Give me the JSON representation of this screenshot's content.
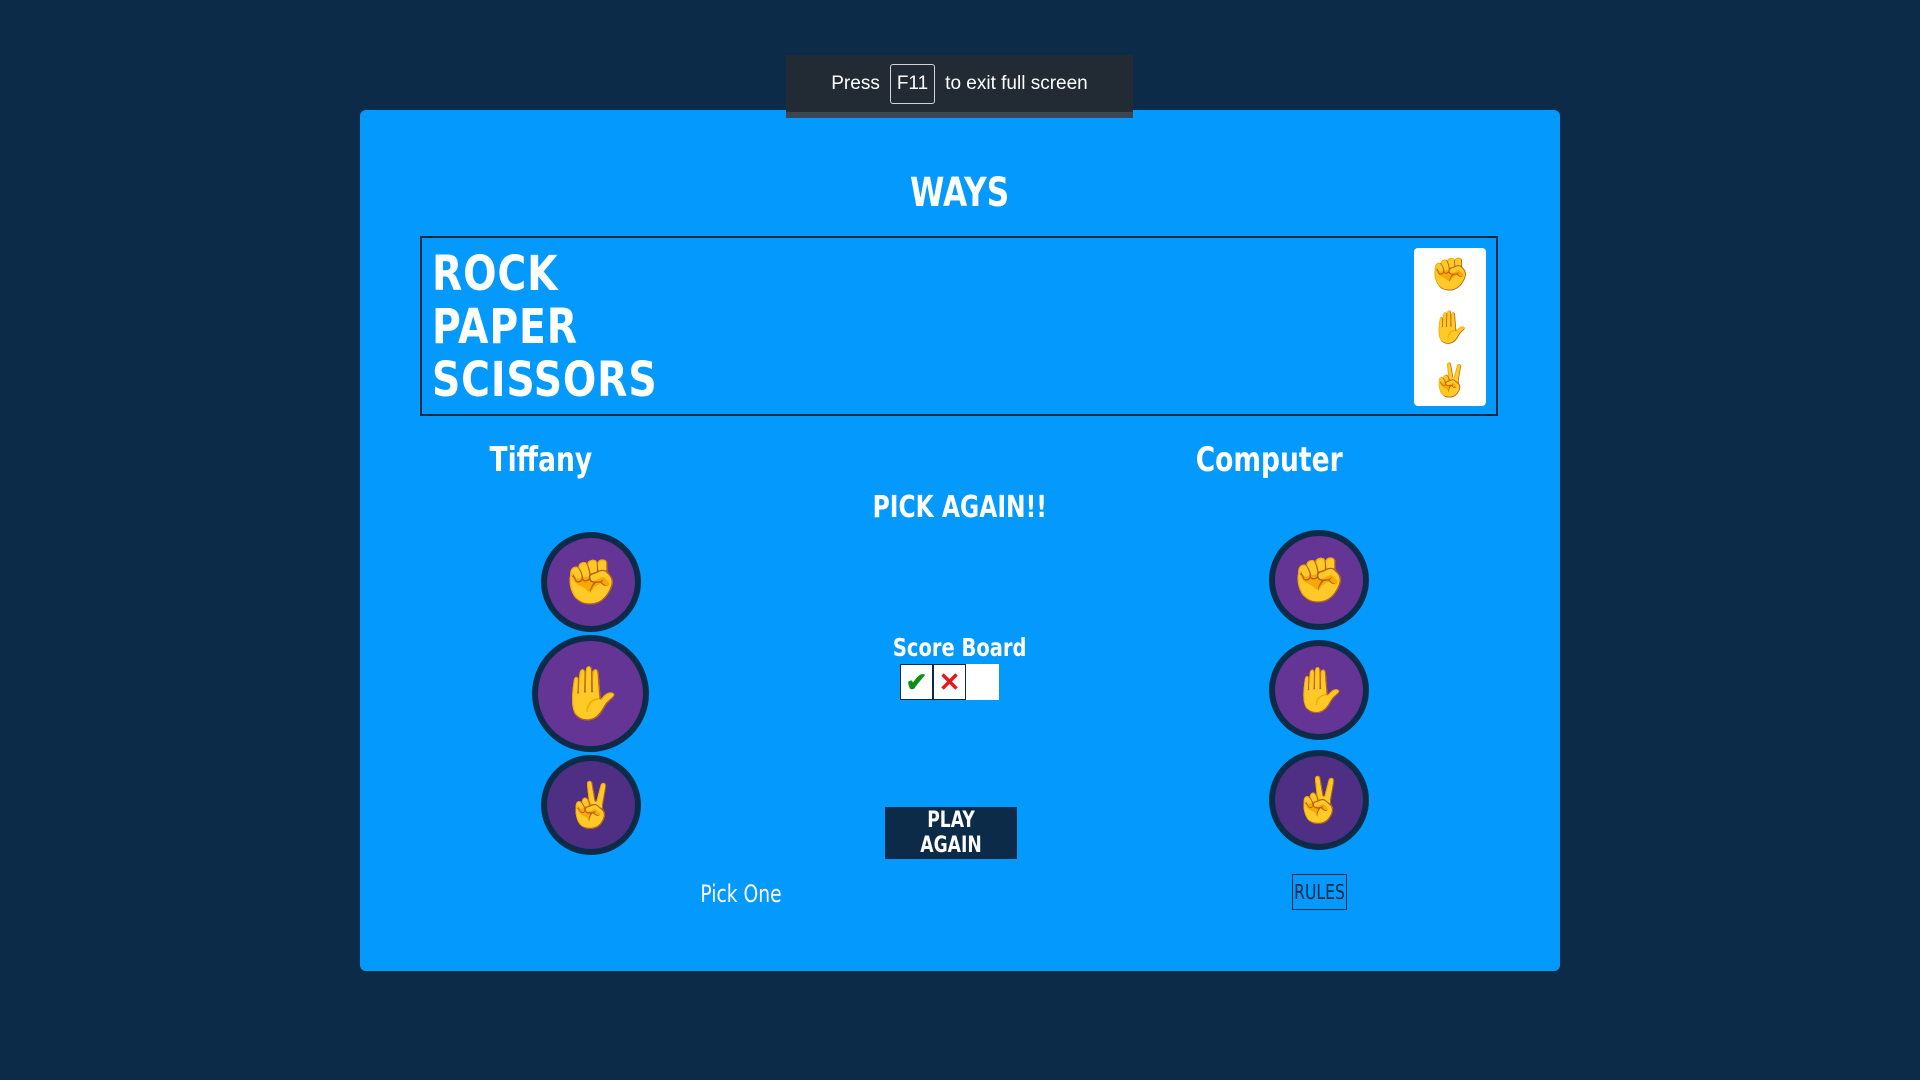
{
  "toast": {
    "press": "Press",
    "key": "F11",
    "rest": "to exit full screen"
  },
  "ways": {
    "title": "WAYS",
    "items": [
      "ROCK",
      "PAPER",
      "SCISSORS"
    ],
    "icons": [
      "rock-icon",
      "paper-icon",
      "scissors-icon"
    ]
  },
  "player": {
    "name": "Tiffany",
    "prompt": "Pick One"
  },
  "computer": {
    "name": "Computer",
    "rules_label": "RULES"
  },
  "status": {
    "message": "PICK AGAIN!!"
  },
  "scoreboard": {
    "title": "Score Board",
    "results": [
      "win",
      "lose",
      "empty"
    ],
    "symbols": {
      "win": "✔",
      "lose": "✕",
      "empty": ""
    },
    "colors": {
      "win": "#0c8f1a",
      "lose": "#e21a1a"
    }
  },
  "actions": {
    "play_again": "PLAY AGAIN"
  },
  "colors": {
    "background": "#0b2b48",
    "panel": "#0399fd",
    "choice_circle": "#643594",
    "icon": "#5f2f98"
  },
  "choice_glyphs": {
    "rock": "✊",
    "paper": "✋",
    "scissors": "✌"
  }
}
